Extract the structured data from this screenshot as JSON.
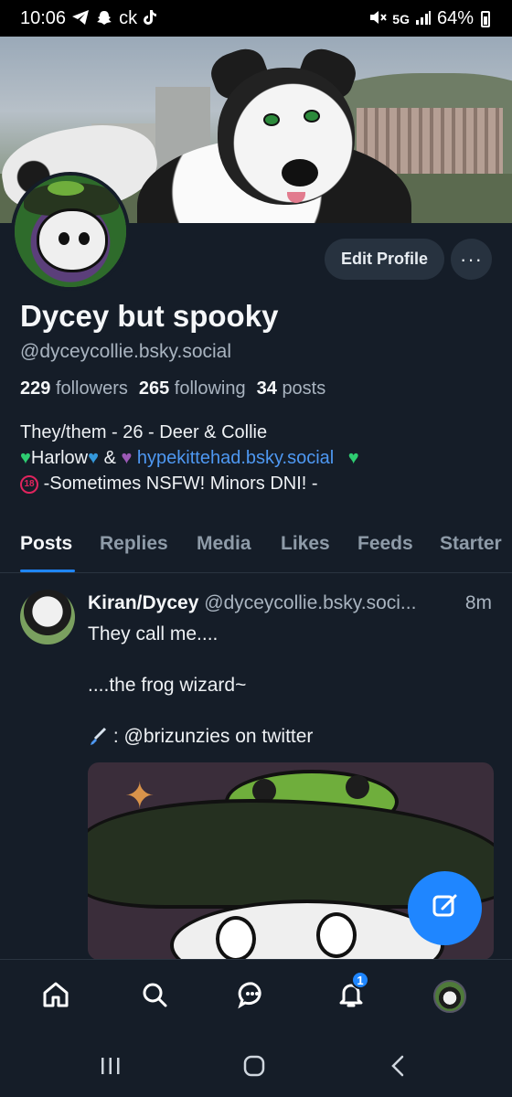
{
  "status_bar": {
    "time": "10:06",
    "carrier_text": "ck",
    "network": "5G",
    "battery": "64%",
    "icons": [
      "telegram-icon",
      "snapchat-icon",
      "tiktok-icon",
      "mute-icon",
      "signal-icon",
      "battery-icon"
    ]
  },
  "profile": {
    "edit_label": "Edit Profile",
    "more_label": "···",
    "display_name": "Dycey but spooky",
    "handle": "@dyceycollie.bsky.social",
    "followers_count": "229",
    "followers_label": "followers",
    "following_count": "265",
    "following_label": "following",
    "posts_count": "34",
    "posts_label": "posts",
    "bio": {
      "line1": "They/them - 26 - Deer & Collie",
      "line2_name1": "Harlow",
      "line2_amp": "&",
      "line2_link": "hypekittehad.bsky.social",
      "line3": "-Sometimes NSFW! Minors DNI! -",
      "nsfw_badge": "18"
    }
  },
  "tabs": [
    {
      "label": "Posts",
      "active": true
    },
    {
      "label": "Replies",
      "active": false
    },
    {
      "label": "Media",
      "active": false
    },
    {
      "label": "Likes",
      "active": false
    },
    {
      "label": "Feeds",
      "active": false
    },
    {
      "label": "Starter",
      "active": false
    }
  ],
  "post": {
    "author": "Kiran/Dycey",
    "handle": "@dyceycollie.bsky.soci...",
    "time": "8m",
    "text1": "They call me....",
    "text2": "....the frog wizard~",
    "text3": ": @brizunzies on twitter"
  },
  "bottom_nav": {
    "items": [
      "home-icon",
      "search-icon",
      "chat-icon",
      "notifications-icon",
      "profile-avatar"
    ],
    "notification_badge": "1"
  },
  "colors": {
    "background": "#151d28",
    "accent": "#1f86ff",
    "link": "#4e98f2",
    "muted": "#a9b4c0"
  }
}
